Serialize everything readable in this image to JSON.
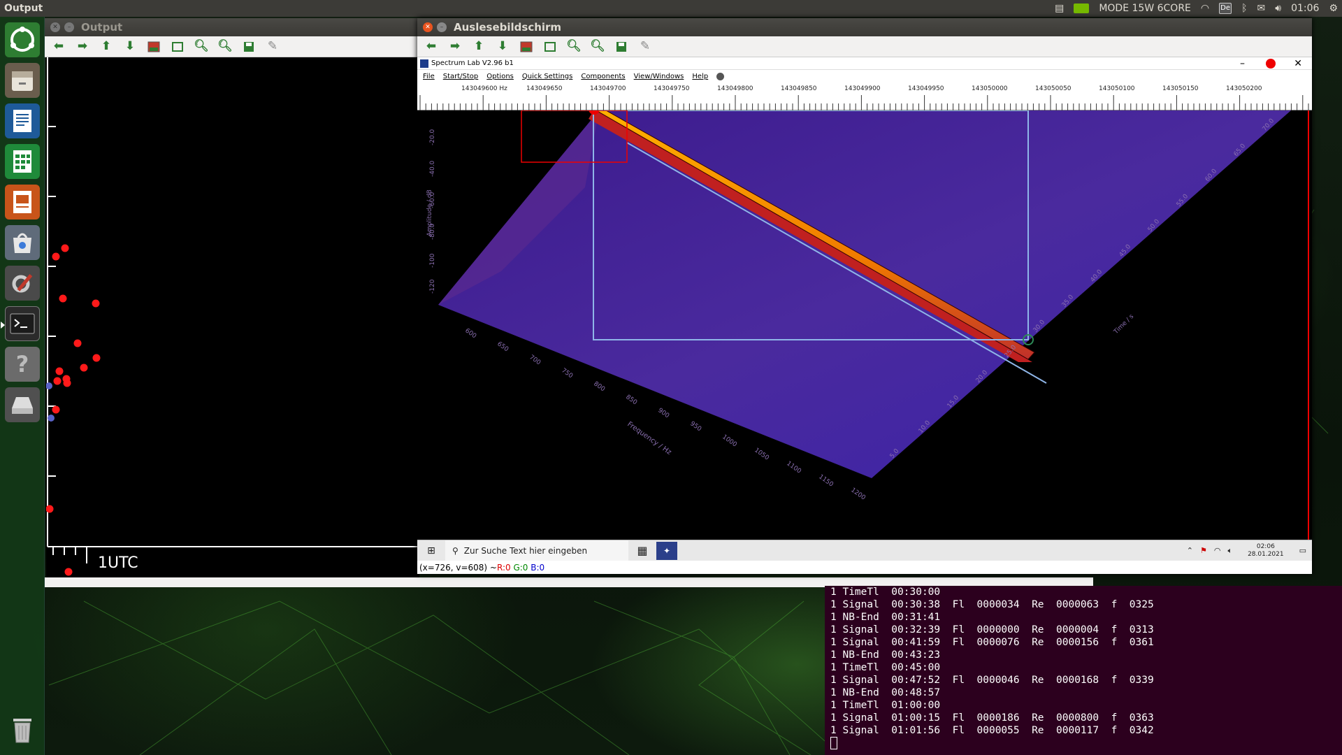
{
  "topbar": {
    "app_title": "Output",
    "mode_label": "MODE 15W 6CORE",
    "keyboard_layout": "De",
    "clock": "01:06"
  },
  "launcher": {
    "items": [
      {
        "icon": "ubuntu-dash-icon"
      },
      {
        "icon": "files-icon"
      },
      {
        "icon": "writer-icon"
      },
      {
        "icon": "calc-icon"
      },
      {
        "icon": "impress-icon"
      },
      {
        "icon": "software-center-icon"
      },
      {
        "icon": "system-settings-icon"
      },
      {
        "icon": "terminal-icon"
      },
      {
        "icon": "help-icon"
      },
      {
        "icon": "drive-icon"
      },
      {
        "icon": "trash-icon"
      }
    ]
  },
  "output_window": {
    "title": "Output",
    "x_axis_label": "1UTC",
    "red_points": [
      [
        80,
        367
      ],
      [
        93,
        355
      ],
      [
        90,
        427
      ],
      [
        137,
        434
      ],
      [
        111,
        491
      ],
      [
        138,
        512
      ],
      [
        120,
        526
      ],
      [
        85,
        531
      ],
      [
        95,
        542
      ],
      [
        82,
        545
      ],
      [
        96,
        548
      ],
      [
        80,
        586
      ],
      [
        71,
        728
      ],
      [
        98,
        818
      ]
    ],
    "blue_points": [
      [
        70,
        552
      ],
      [
        73,
        598
      ]
    ]
  },
  "spectrum_window": {
    "title": "Auslesebildschirm",
    "app_title": "Spectrum Lab V2.96 b1",
    "menu": [
      "File",
      "Start/Stop",
      "Options",
      "Quick Settings",
      "Components",
      "View/Windows",
      "Help"
    ],
    "ruler_labels": [
      "143049600 Hz",
      "143049650",
      "143049700",
      "143049750",
      "143049800",
      "143049850",
      "143049900",
      "143049950",
      "143050000",
      "143050050",
      "143050100",
      "143050150",
      "143050200"
    ],
    "amplitude_label": "Amplitude / dB",
    "amplitude_ticks": [
      "-20.0",
      "-40.0",
      "-60.0",
      "-80.0",
      "-100",
      "-120"
    ],
    "frequency_label": "Frequency / Hz",
    "frequency_ticks": [
      "600",
      "650",
      "700",
      "750",
      "800",
      "850",
      "900",
      "950",
      "1000",
      "1050",
      "1100",
      "1150",
      "1200"
    ],
    "time_label": "Time / s",
    "time_ticks": [
      "70.0",
      "65.0",
      "60.0",
      "55.0",
      "50.0",
      "45.0",
      "40.0",
      "35.0",
      "30.0",
      "25.0",
      "20.0",
      "15.0",
      "10.0",
      "5.0"
    ],
    "taskbar": {
      "search_placeholder": "Zur Suche Text hier eingeben",
      "time": "02:06",
      "date": "28.01.2021"
    },
    "status": {
      "coords": "(x=726, v=608) ~ ",
      "r": "R:0",
      "g": "G:0",
      "b": "B:0"
    }
  },
  "terminal": {
    "lines": [
      "1 TimeTl  00:30:00",
      "1 Signal  00:30:38  Fl  0000034  Re  0000063  f  0325",
      "1 NB-End  00:31:41",
      "1 Signal  00:32:39  Fl  0000000  Re  0000004  f  0313",
      "1 Signal  00:41:59  Fl  0000076  Re  0000156  f  0361",
      "1 NB-End  00:43:23",
      "1 TimeTl  00:45:00",
      "1 Signal  00:47:52  Fl  0000046  Re  0000168  f  0339",
      "1 NB-End  00:48:57",
      "1 TimeTl  01:00:00",
      "1 Signal  01:00:15  Fl  0000186  Re  0000800  f  0363",
      "1 Signal  01:01:56  Fl  0000055  Re  0000117  f  0342"
    ]
  }
}
